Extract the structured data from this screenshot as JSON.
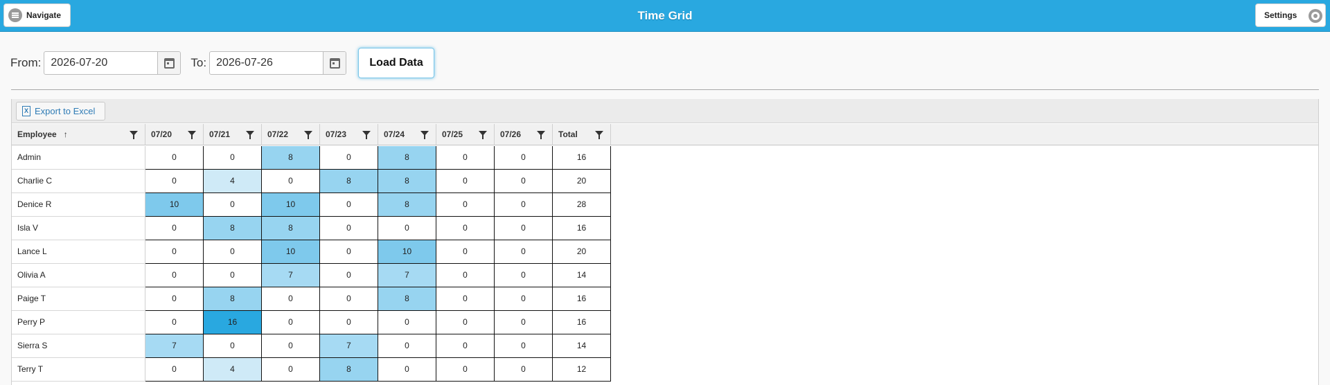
{
  "header": {
    "title": "Time Grid",
    "navigate_label": "Navigate",
    "settings_label": "Settings"
  },
  "filters": {
    "from_label": "From:",
    "from_value": "2026-07-20",
    "to_label": "To:",
    "to_value": "2026-07-26",
    "load_label": "Load Data"
  },
  "toolbar": {
    "export_label": "Export to Excel"
  },
  "colors": {
    "accent": "#29a8e0",
    "level_4": "#cfeaf7",
    "level_7": "#a6daf3",
    "level_8": "#97d4f0",
    "level_10": "#7ec9ec",
    "level_16": "#29a8e0"
  },
  "icons": {
    "navigate": "hamburger-icon",
    "settings": "gear-icon",
    "date": "calendar-icon",
    "export": "excel-icon",
    "filter": "filter-icon",
    "sort": "sort-ascending-icon"
  },
  "grid": {
    "columns": [
      "Employee",
      "07/20",
      "07/21",
      "07/22",
      "07/23",
      "07/24",
      "07/25",
      "07/26",
      "Total"
    ],
    "sort_indicator": "↑",
    "rows": [
      {
        "employee": "Admin",
        "values": [
          0,
          0,
          8,
          0,
          8,
          0,
          0
        ],
        "total": 16
      },
      {
        "employee": "Charlie C",
        "values": [
          0,
          4,
          0,
          8,
          8,
          0,
          0
        ],
        "total": 20
      },
      {
        "employee": "Denice R",
        "values": [
          10,
          0,
          10,
          0,
          8,
          0,
          0
        ],
        "total": 28
      },
      {
        "employee": "Isla V",
        "values": [
          0,
          8,
          8,
          0,
          0,
          0,
          0
        ],
        "total": 16
      },
      {
        "employee": "Lance L",
        "values": [
          0,
          0,
          10,
          0,
          10,
          0,
          0
        ],
        "total": 20
      },
      {
        "employee": "Olivia A",
        "values": [
          0,
          0,
          7,
          0,
          7,
          0,
          0
        ],
        "total": 14
      },
      {
        "employee": "Paige T",
        "values": [
          0,
          8,
          0,
          0,
          8,
          0,
          0
        ],
        "total": 16
      },
      {
        "employee": "Perry P",
        "values": [
          0,
          16,
          0,
          0,
          0,
          0,
          0
        ],
        "total": 16
      },
      {
        "employee": "Sierra S",
        "values": [
          7,
          0,
          0,
          7,
          0,
          0,
          0
        ],
        "total": 14
      },
      {
        "employee": "Terry T",
        "values": [
          0,
          4,
          0,
          8,
          0,
          0,
          0
        ],
        "total": 12
      }
    ]
  }
}
